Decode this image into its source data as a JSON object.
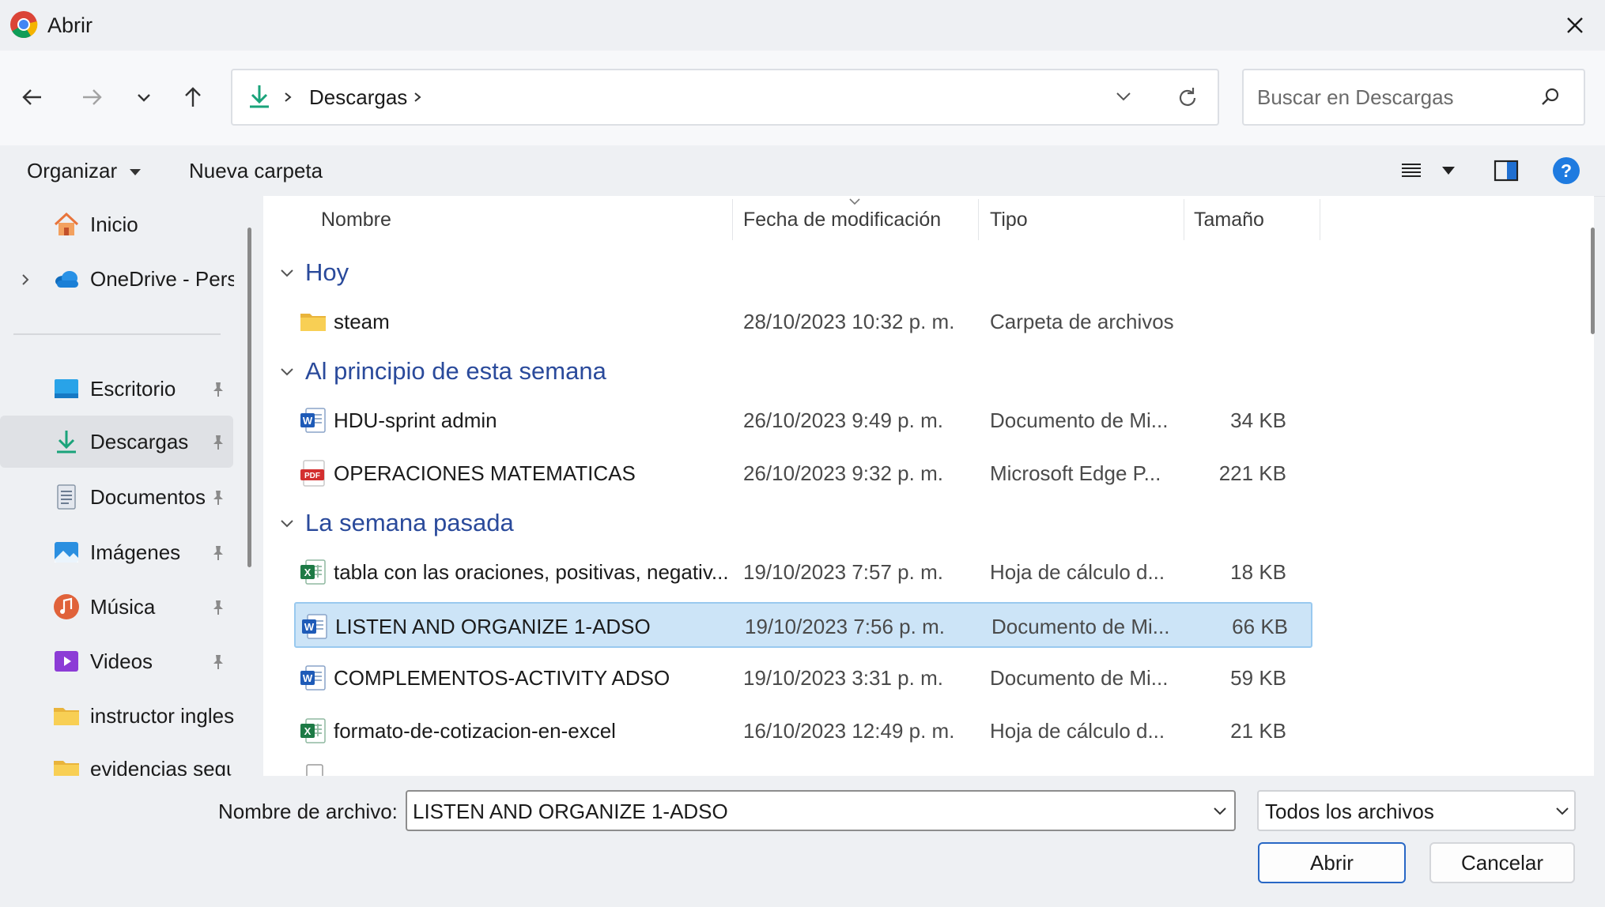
{
  "window": {
    "title": "Abrir"
  },
  "address": {
    "location_label": "Descargas",
    "separator": ">"
  },
  "search": {
    "placeholder": "Buscar en Descargas"
  },
  "commandbar": {
    "organize_label": "Organizar",
    "new_folder_label": "Nueva carpeta"
  },
  "sidebar": {
    "items": [
      {
        "label": "Inicio",
        "icon": "home-icon"
      },
      {
        "label": "OneDrive - Personal",
        "icon": "onedrive-icon"
      },
      {
        "label": "Escritorio",
        "icon": "desktop-icon"
      },
      {
        "label": "Descargas",
        "icon": "downloads-icon"
      },
      {
        "label": "Documentos",
        "icon": "documents-icon"
      },
      {
        "label": "Imágenes",
        "icon": "pictures-icon"
      },
      {
        "label": "Música",
        "icon": "music-icon"
      },
      {
        "label": "Videos",
        "icon": "videos-icon"
      },
      {
        "label": "instructor ingles",
        "icon": "folder-icon"
      },
      {
        "label": "evidencias segu",
        "icon": "folder-icon"
      }
    ]
  },
  "columns": {
    "name": "Nombre",
    "date": "Fecha de modificación",
    "type": "Tipo",
    "size": "Tamaño"
  },
  "groups": [
    {
      "label": "Hoy"
    },
    {
      "label": "Al principio de esta semana"
    },
    {
      "label": "La semana pasada"
    }
  ],
  "files": [
    {
      "name": "steam",
      "date": "28/10/2023 10:32 p. m.",
      "type": "Carpeta de archivos",
      "size": "",
      "icon": "folder-icon"
    },
    {
      "name": "HDU-sprint admin",
      "date": "26/10/2023 9:49 p. m.",
      "type": "Documento de Mi...",
      "size": "34 KB",
      "icon": "word-icon"
    },
    {
      "name": "OPERACIONES MATEMATICAS",
      "date": "26/10/2023 9:32 p. m.",
      "type": "Microsoft Edge P...",
      "size": "221 KB",
      "icon": "pdf-icon"
    },
    {
      "name": "tabla con las oraciones, positivas, negativ...",
      "date": "19/10/2023 7:57 p. m.",
      "type": "Hoja de cálculo d...",
      "size": "18 KB",
      "icon": "excel-icon"
    },
    {
      "name": "LISTEN AND ORGANIZE 1-ADSO",
      "date": "19/10/2023 7:56 p. m.",
      "type": "Documento de Mi...",
      "size": "66 KB",
      "icon": "word-icon"
    },
    {
      "name": "COMPLEMENTOS-ACTIVITY ADSO",
      "date": "19/10/2023 3:31 p. m.",
      "type": "Documento de Mi...",
      "size": "59 KB",
      "icon": "word-icon"
    },
    {
      "name": "formato-de-cotizacion-en-excel",
      "date": "16/10/2023 12:49 p. m.",
      "type": "Hoja de cálculo d...",
      "size": "21 KB",
      "icon": "excel-icon"
    }
  ],
  "footer": {
    "filename_label": "Nombre de archivo:",
    "filename_value": "LISTEN AND ORGANIZE 1-ADSO",
    "filter_value": "Todos los archivos",
    "open_label": "Abrir",
    "cancel_label": "Cancelar"
  },
  "colors": {
    "accent": "#2867c5",
    "selection": "#cce4f7",
    "group_text": "#2a4a9b"
  }
}
